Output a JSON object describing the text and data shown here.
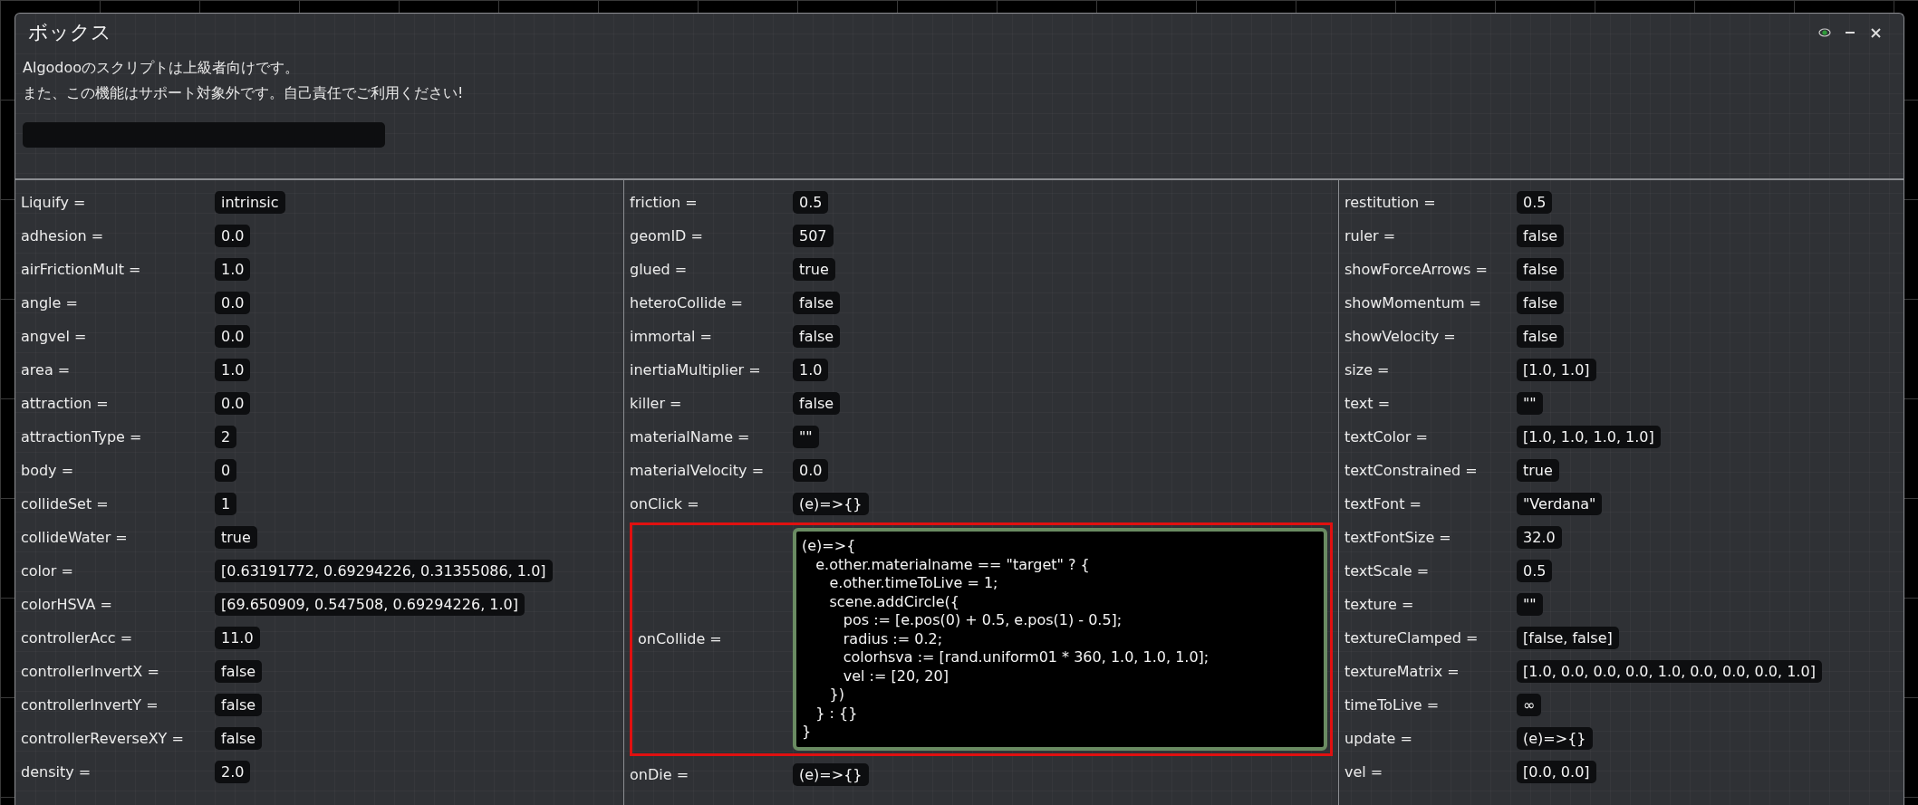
{
  "window": {
    "title": "ボックス"
  },
  "notice": [
    "Algodooのスクリプトは上級者向けです。",
    "また、この機能はサポート対象外です。自己責任でご利用ください!"
  ],
  "columns": [
    {
      "rows": [
        {
          "label": "Liquify =",
          "value": "intrinsic",
          "kind": "value",
          "highlighted": false
        },
        {
          "label": "adhesion =",
          "value": "0.0",
          "kind": "value",
          "highlighted": false
        },
        {
          "label": "airFrictionMult =",
          "value": "1.0",
          "kind": "value",
          "highlighted": false
        },
        {
          "label": "angle =",
          "value": "0.0",
          "kind": "value",
          "highlighted": false
        },
        {
          "label": "angvel =",
          "value": "0.0",
          "kind": "value",
          "highlighted": false
        },
        {
          "label": "area =",
          "value": "1.0",
          "kind": "value",
          "highlighted": false
        },
        {
          "label": "attraction =",
          "value": "0.0",
          "kind": "value",
          "highlighted": false
        },
        {
          "label": "attractionType =",
          "value": "2",
          "kind": "value",
          "highlighted": false
        },
        {
          "label": "body =",
          "value": "0",
          "kind": "value",
          "highlighted": false
        },
        {
          "label": "collideSet =",
          "value": "1",
          "kind": "value",
          "highlighted": false
        },
        {
          "label": "collideWater =",
          "value": "true",
          "kind": "value",
          "highlighted": false
        },
        {
          "label": "color =",
          "value": "[0.63191772, 0.69294226, 0.31355086, 1.0]",
          "kind": "value",
          "highlighted": false
        },
        {
          "label": "colorHSVA =",
          "value": "[69.650909, 0.547508, 0.69294226, 1.0]",
          "kind": "value",
          "highlighted": false
        },
        {
          "label": "controllerAcc =",
          "value": "11.0",
          "kind": "value",
          "highlighted": false
        },
        {
          "label": "controllerInvertX =",
          "value": "false",
          "kind": "value",
          "highlighted": false
        },
        {
          "label": "controllerInvertY =",
          "value": "false",
          "kind": "value",
          "highlighted": false
        },
        {
          "label": "controllerReverseXY =",
          "value": "false",
          "kind": "value",
          "highlighted": false
        },
        {
          "label": "density =",
          "value": "2.0",
          "kind": "value",
          "highlighted": false
        }
      ]
    },
    {
      "rows": [
        {
          "label": "friction =",
          "value": "0.5",
          "kind": "value",
          "highlighted": false
        },
        {
          "label": "geomID =",
          "value": "507",
          "kind": "value",
          "highlighted": false
        },
        {
          "label": "glued =",
          "value": "true",
          "kind": "value",
          "highlighted": false
        },
        {
          "label": "heteroCollide =",
          "value": "false",
          "kind": "value",
          "highlighted": false
        },
        {
          "label": "immortal =",
          "value": "false",
          "kind": "value",
          "highlighted": false
        },
        {
          "label": "inertiaMultiplier =",
          "value": "1.0",
          "kind": "value",
          "highlighted": false
        },
        {
          "label": "killer =",
          "value": "false",
          "kind": "value",
          "highlighted": false
        },
        {
          "label": "materialName =",
          "value": "\"\"",
          "kind": "value",
          "highlighted": false
        },
        {
          "label": "materialVelocity =",
          "value": "0.0",
          "kind": "value",
          "highlighted": false
        },
        {
          "label": "onClick =",
          "value": "(e)=>{}",
          "kind": "value",
          "highlighted": false
        },
        {
          "label": "onCollide =",
          "value": "(e)=>{\n   e.other.materialname == \"target\" ? {\n      e.other.timeToLive = 1;\n      scene.addCircle({\n         pos := [e.pos(0) + 0.5, e.pos(1) - 0.5];\n         radius := 0.2;\n         colorhsva := [rand.uniform01 * 360, 1.0, 1.0, 1.0];\n         vel := [20, 20]\n      })\n   } : {}\n}",
          "kind": "code",
          "highlighted": true
        },
        {
          "label": "onDie =",
          "value": "(e)=>{}",
          "kind": "value",
          "highlighted": false
        }
      ]
    },
    {
      "rows": [
        {
          "label": "restitution =",
          "value": "0.5",
          "kind": "value",
          "highlighted": false
        },
        {
          "label": "ruler =",
          "value": "false",
          "kind": "value",
          "highlighted": false
        },
        {
          "label": "showForceArrows =",
          "value": "false",
          "kind": "value",
          "highlighted": false
        },
        {
          "label": "showMomentum =",
          "value": "false",
          "kind": "value",
          "highlighted": false
        },
        {
          "label": "showVelocity =",
          "value": "false",
          "kind": "value",
          "highlighted": false
        },
        {
          "label": "size =",
          "value": "[1.0, 1.0]",
          "kind": "value",
          "highlighted": false
        },
        {
          "label": "text =",
          "value": "\"\"",
          "kind": "value",
          "highlighted": false
        },
        {
          "label": "textColor =",
          "value": "[1.0, 1.0, 1.0, 1.0]",
          "kind": "value",
          "highlighted": false
        },
        {
          "label": "textConstrained =",
          "value": "true",
          "kind": "value",
          "highlighted": false
        },
        {
          "label": "textFont =",
          "value": "\"Verdana\"",
          "kind": "value",
          "highlighted": false
        },
        {
          "label": "textFontSize =",
          "value": "32.0",
          "kind": "value",
          "highlighted": false
        },
        {
          "label": "textScale =",
          "value": "0.5",
          "kind": "value",
          "highlighted": false
        },
        {
          "label": "texture =",
          "value": "\"\"",
          "kind": "value",
          "highlighted": false
        },
        {
          "label": "textureClamped =",
          "value": "[false, false]",
          "kind": "value",
          "highlighted": false
        },
        {
          "label": "textureMatrix =",
          "value": "[1.0, 0.0, 0.0, 0.0, 1.0, 0.0, 0.0, 0.0, 1.0]",
          "kind": "value",
          "highlighted": false
        },
        {
          "label": "timeToLive =",
          "value": "∞",
          "kind": "value",
          "highlighted": false
        },
        {
          "label": "update =",
          "value": "(e)=>{}",
          "kind": "value",
          "highlighted": false
        },
        {
          "label": "vel =",
          "value": "[0.0, 0.0]",
          "kind": "value",
          "highlighted": false
        }
      ]
    }
  ]
}
